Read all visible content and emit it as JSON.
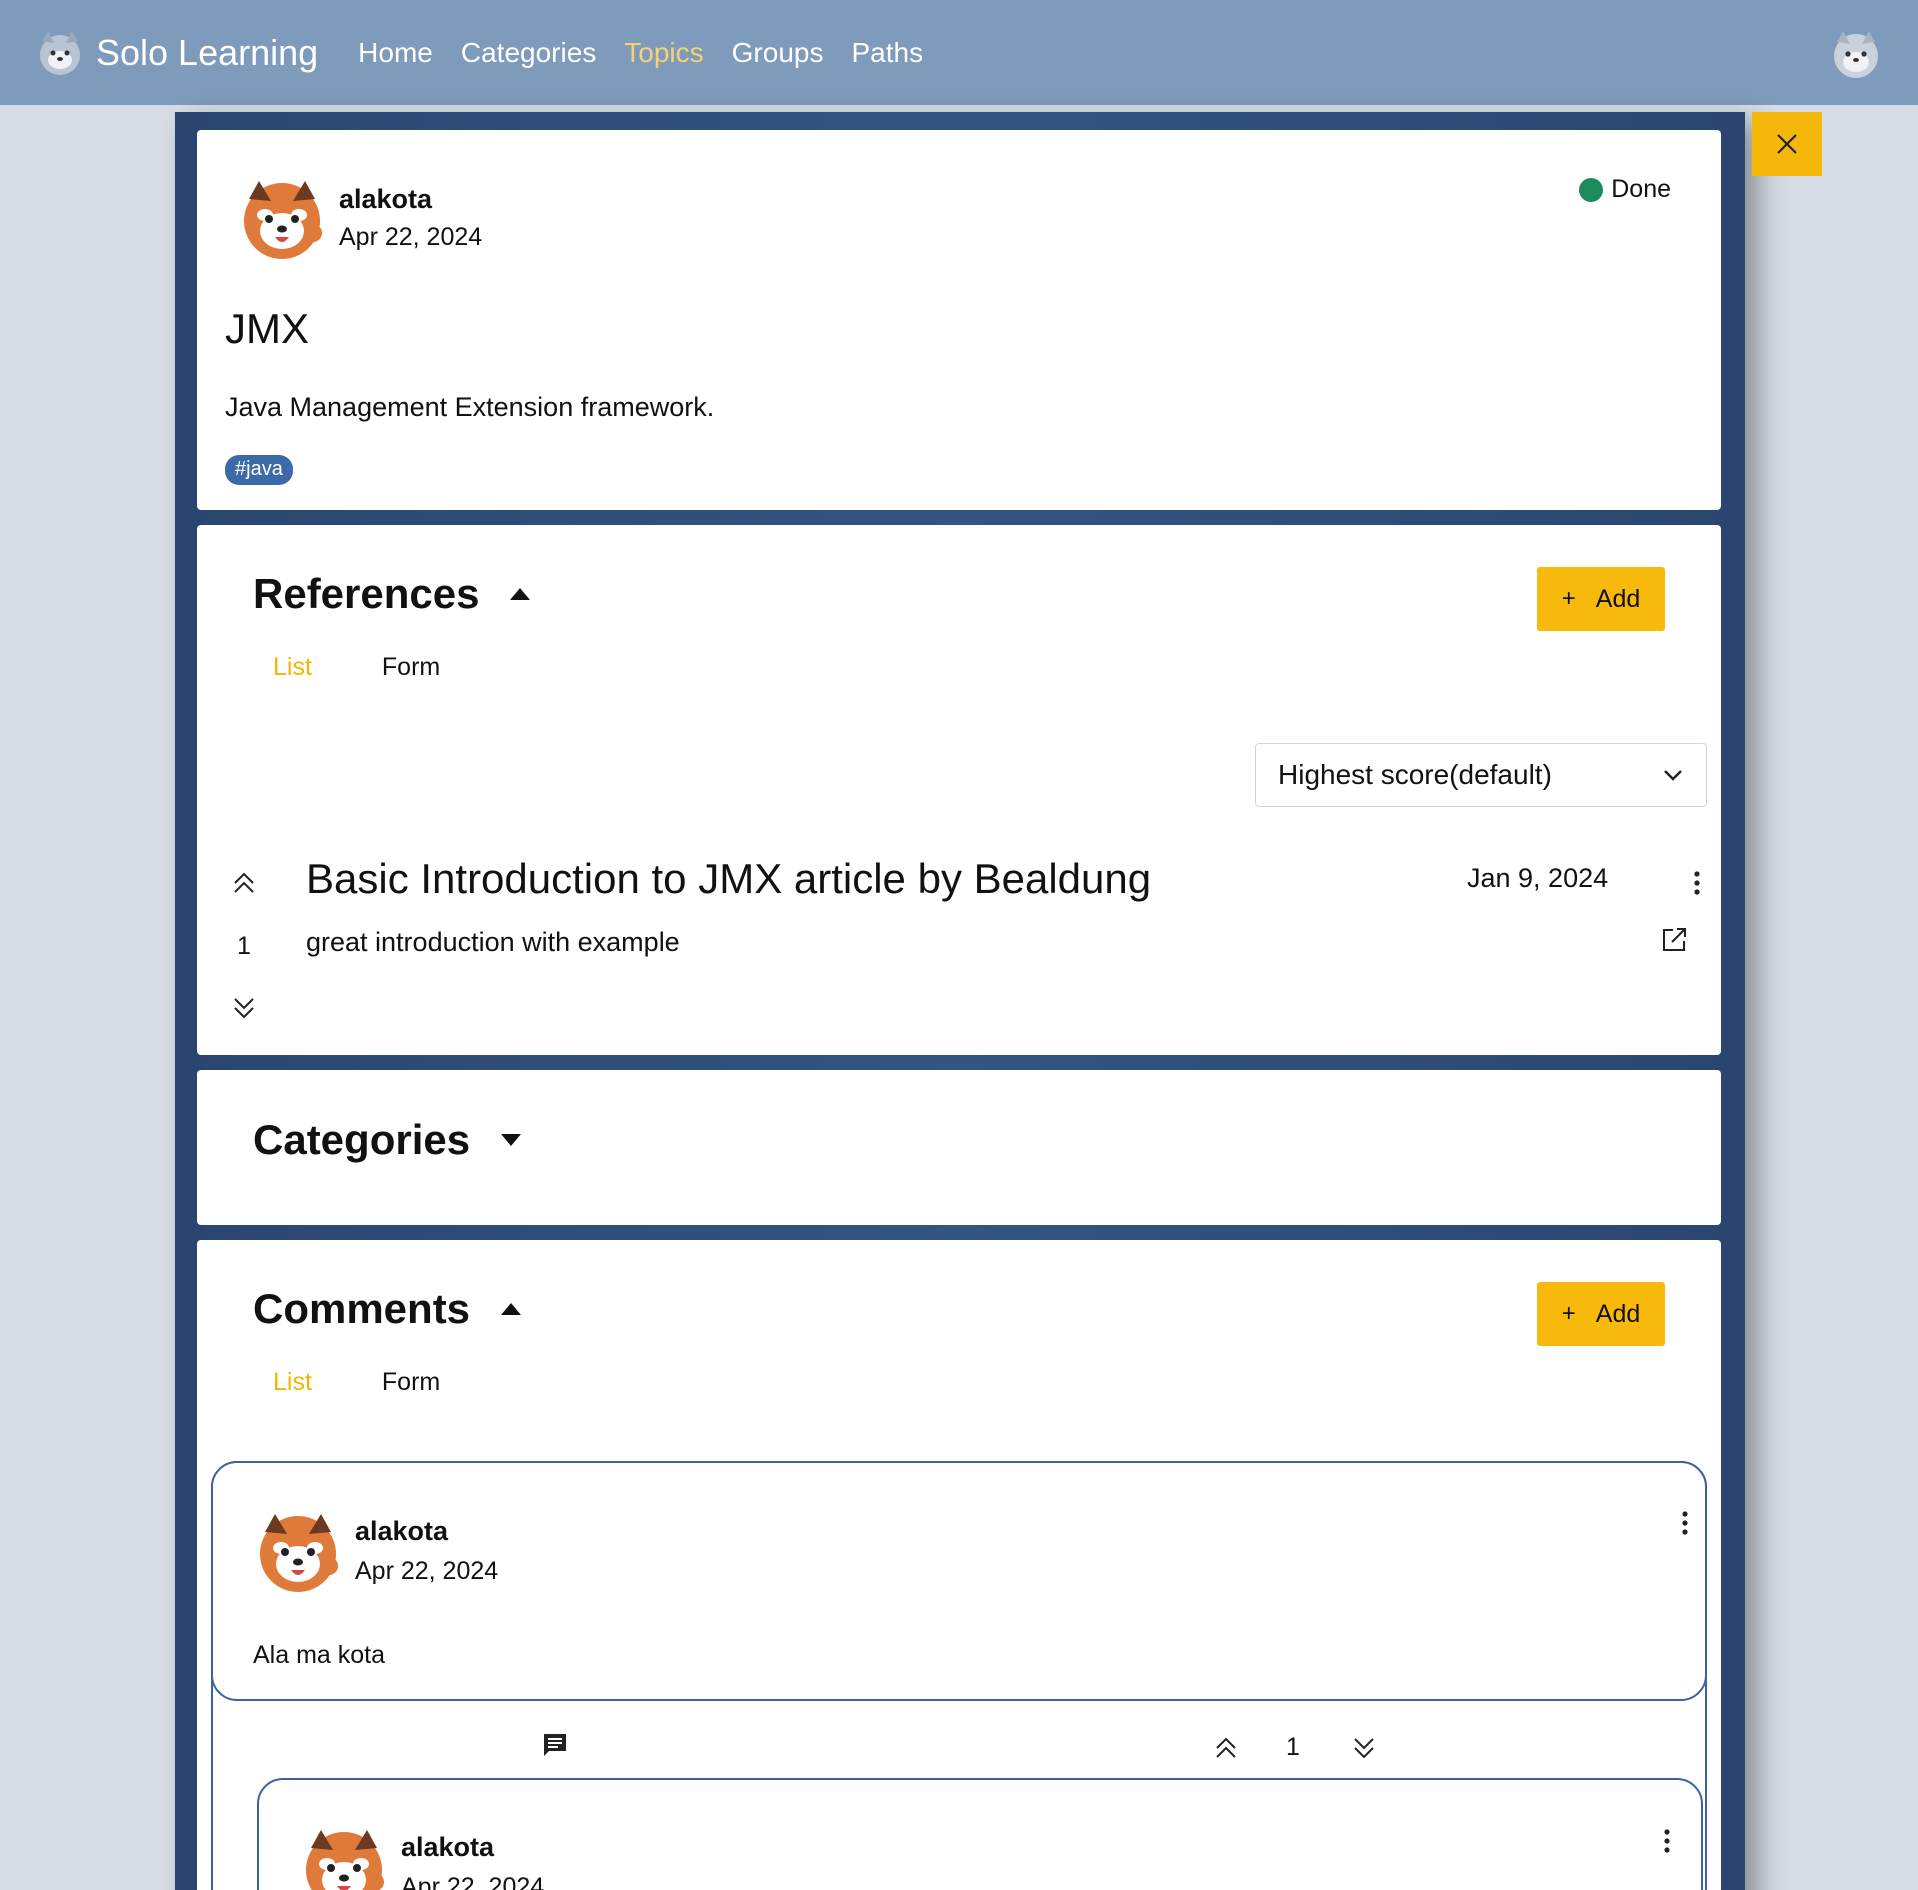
{
  "navbar": {
    "brand": "Solo Learning",
    "links": [
      {
        "label": "Home",
        "active": false
      },
      {
        "label": "Categories",
        "active": false
      },
      {
        "label": "Topics",
        "active": true
      },
      {
        "label": "Groups",
        "active": false
      },
      {
        "label": "Paths",
        "active": false
      }
    ]
  },
  "topic": {
    "author": "alakota",
    "date": "Apr 22, 2024",
    "status": "Done",
    "status_color": "#1c8a5a",
    "title": "JMX",
    "description": "Java Management Extension framework.",
    "tags": [
      "#java"
    ]
  },
  "references": {
    "title": "References",
    "add_label": "Add",
    "tabs": {
      "list": "List",
      "form": "Form"
    },
    "sort": "Highest score(default)",
    "items": [
      {
        "title": "Basic Introduction to JMX article by Bealdung",
        "description": "great introduction with example",
        "date": "Jan 9, 2024",
        "score": "1"
      }
    ]
  },
  "categories": {
    "title": "Categories"
  },
  "comments": {
    "title": "Comments",
    "add_label": "Add",
    "tabs": {
      "list": "List",
      "form": "Form"
    },
    "items": [
      {
        "author": "alakota",
        "date": "Apr 22, 2024",
        "text": "Ala ma kota",
        "score": "1",
        "replies": [
          {
            "author": "alakota",
            "date": "Apr 22, 2024"
          }
        ]
      }
    ]
  },
  "colors": {
    "navbar": "#7f9bbb",
    "accent": "#f7b90c",
    "modal": "#2a4670",
    "active_link": "#f3d27a"
  }
}
